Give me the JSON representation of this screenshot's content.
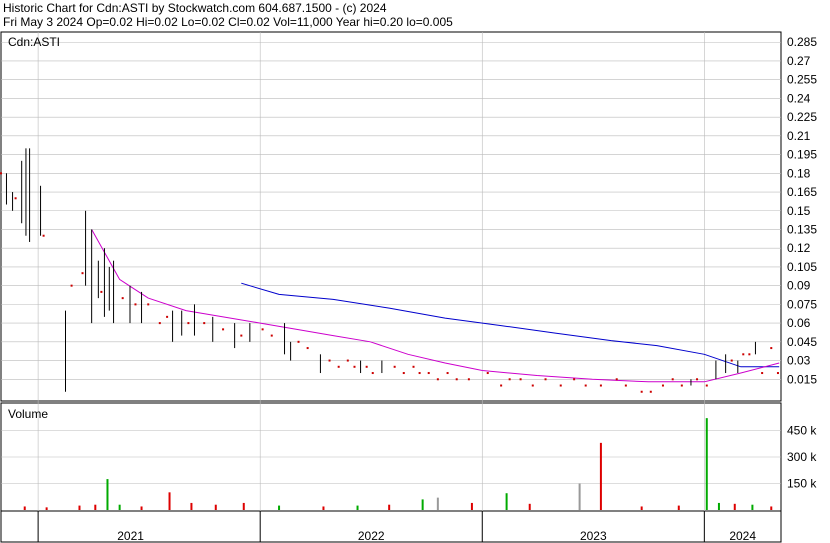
{
  "header": {
    "title": "Historic Chart for Cdn:ASTI by Stockwatch.com 604.687.1500 - (c) 2024",
    "summary": "Fri May  3 2024  Op=0.02  Hi=0.02  Lo=0.02  Cl=0.02  Vol=11,000  Year hi=0.20  lo=0.005"
  },
  "chart_data": [
    {
      "type": "ohlc",
      "panel_label": "Cdn:ASTI",
      "yticks": [
        "0.285",
        "0.27",
        "0.255",
        "0.24",
        "0.225",
        "0.21",
        "0.195",
        "0.18",
        "0.165",
        "0.15",
        "0.135",
        "0.12",
        "0.105",
        "0.09",
        "0.075",
        "0.06",
        "0.045",
        "0.03",
        "0.015"
      ],
      "ylim": [
        0.0,
        0.29
      ],
      "x_range": [
        "2020-11",
        "2024-05"
      ],
      "colors": {
        "bar": "#000000",
        "dot": "#cc0000",
        "ma_short": "#cc00cc",
        "ma_long": "#0000cc",
        "grid": "#bbbbbb"
      },
      "bars": [
        {
          "date": "2020-11-10",
          "high": 0.18,
          "low": 0.155
        },
        {
          "date": "2020-11-20",
          "high": 0.165,
          "low": 0.15
        },
        {
          "date": "2020-12-05",
          "high": 0.19,
          "low": 0.14
        },
        {
          "date": "2020-12-12",
          "high": 0.2,
          "low": 0.13
        },
        {
          "date": "2020-12-18",
          "high": 0.2,
          "low": 0.125
        },
        {
          "date": "2021-01-05",
          "high": 0.17,
          "low": 0.13
        },
        {
          "date": "2021-02-15",
          "high": 0.07,
          "low": 0.005
        },
        {
          "date": "2021-03-20",
          "high": 0.15,
          "low": 0.09
        },
        {
          "date": "2021-03-30",
          "high": 0.135,
          "low": 0.06
        },
        {
          "date": "2021-04-10",
          "high": 0.11,
          "low": 0.08
        },
        {
          "date": "2021-04-20",
          "high": 0.12,
          "low": 0.065
        },
        {
          "date": "2021-04-28",
          "high": 0.105,
          "low": 0.07
        },
        {
          "date": "2021-05-05",
          "high": 0.11,
          "low": 0.06
        },
        {
          "date": "2021-06-01",
          "high": 0.09,
          "low": 0.06
        },
        {
          "date": "2021-06-20",
          "high": 0.085,
          "low": 0.06
        },
        {
          "date": "2021-08-10",
          "high": 0.07,
          "low": 0.045
        },
        {
          "date": "2021-08-25",
          "high": 0.07,
          "low": 0.05
        },
        {
          "date": "2021-09-15",
          "high": 0.075,
          "low": 0.05
        },
        {
          "date": "2021-10-15",
          "high": 0.065,
          "low": 0.045
        },
        {
          "date": "2021-11-20",
          "high": 0.06,
          "low": 0.04
        },
        {
          "date": "2021-12-15",
          "high": 0.06,
          "low": 0.045
        },
        {
          "date": "2022-02-10",
          "high": 0.06,
          "low": 0.035
        },
        {
          "date": "2022-02-20",
          "high": 0.045,
          "low": 0.03
        },
        {
          "date": "2022-04-10",
          "high": 0.035,
          "low": 0.02
        },
        {
          "date": "2022-06-15",
          "high": 0.03,
          "low": 0.02
        },
        {
          "date": "2022-07-20",
          "high": 0.03,
          "low": 0.02
        },
        {
          "date": "2023-12-10",
          "high": 0.015,
          "low": 0.01
        },
        {
          "date": "2024-01-20",
          "high": 0.03,
          "low": 0.015
        },
        {
          "date": "2024-02-05",
          "high": 0.035,
          "low": 0.02
        },
        {
          "date": "2024-02-25",
          "high": 0.03,
          "low": 0.02
        },
        {
          "date": "2024-03-25",
          "high": 0.045,
          "low": 0.035
        }
      ],
      "dots": [
        {
          "date": "2020-11-01",
          "price": 0.18
        },
        {
          "date": "2020-11-25",
          "price": 0.16
        },
        {
          "date": "2021-01-10",
          "price": 0.13
        },
        {
          "date": "2021-02-25",
          "price": 0.09
        },
        {
          "date": "2021-03-15",
          "price": 0.1
        },
        {
          "date": "2021-04-15",
          "price": 0.085
        },
        {
          "date": "2021-05-20",
          "price": 0.08
        },
        {
          "date": "2021-06-10",
          "price": 0.075
        },
        {
          "date": "2021-07-01",
          "price": 0.075
        },
        {
          "date": "2021-07-20",
          "price": 0.06
        },
        {
          "date": "2021-08-01",
          "price": 0.065
        },
        {
          "date": "2021-09-05",
          "price": 0.06
        },
        {
          "date": "2021-10-01",
          "price": 0.06
        },
        {
          "date": "2021-11-01",
          "price": 0.055
        },
        {
          "date": "2021-12-01",
          "price": 0.05
        },
        {
          "date": "2022-01-05",
          "price": 0.055
        },
        {
          "date": "2022-01-20",
          "price": 0.05
        },
        {
          "date": "2022-03-05",
          "price": 0.045
        },
        {
          "date": "2022-03-20",
          "price": 0.04
        },
        {
          "date": "2022-04-25",
          "price": 0.03
        },
        {
          "date": "2022-05-10",
          "price": 0.025
        },
        {
          "date": "2022-05-25",
          "price": 0.03
        },
        {
          "date": "2022-06-05",
          "price": 0.025
        },
        {
          "date": "2022-06-25",
          "price": 0.025
        },
        {
          "date": "2022-07-05",
          "price": 0.02
        },
        {
          "date": "2022-08-10",
          "price": 0.025
        },
        {
          "date": "2022-08-25",
          "price": 0.02
        },
        {
          "date": "2022-09-10",
          "price": 0.025
        },
        {
          "date": "2022-09-20",
          "price": 0.02
        },
        {
          "date": "2022-10-05",
          "price": 0.02
        },
        {
          "date": "2022-10-20",
          "price": 0.015
        },
        {
          "date": "2022-11-05",
          "price": 0.02
        },
        {
          "date": "2022-11-20",
          "price": 0.015
        },
        {
          "date": "2022-12-10",
          "price": 0.015
        },
        {
          "date": "2023-01-10",
          "price": 0.02
        },
        {
          "date": "2023-02-01",
          "price": 0.01
        },
        {
          "date": "2023-02-15",
          "price": 0.015
        },
        {
          "date": "2023-03-05",
          "price": 0.015
        },
        {
          "date": "2023-03-25",
          "price": 0.01
        },
        {
          "date": "2023-04-15",
          "price": 0.015
        },
        {
          "date": "2023-05-10",
          "price": 0.01
        },
        {
          "date": "2023-06-01",
          "price": 0.015
        },
        {
          "date": "2023-06-20",
          "price": 0.01
        },
        {
          "date": "2023-07-15",
          "price": 0.01
        },
        {
          "date": "2023-08-10",
          "price": 0.015
        },
        {
          "date": "2023-08-25",
          "price": 0.01
        },
        {
          "date": "2023-09-20",
          "price": 0.005
        },
        {
          "date": "2023-10-05",
          "price": 0.005
        },
        {
          "date": "2023-10-25",
          "price": 0.01
        },
        {
          "date": "2023-11-10",
          "price": 0.015
        },
        {
          "date": "2023-11-25",
          "price": 0.01
        },
        {
          "date": "2023-12-20",
          "price": 0.015
        },
        {
          "date": "2024-01-05",
          "price": 0.01
        },
        {
          "date": "2024-02-15",
          "price": 0.03
        },
        {
          "date": "2024-03-05",
          "price": 0.035
        },
        {
          "date": "2024-03-15",
          "price": 0.035
        },
        {
          "date": "2024-04-05",
          "price": 0.02
        },
        {
          "date": "2024-04-20",
          "price": 0.04
        },
        {
          "date": "2024-05-01",
          "price": 0.02
        }
      ],
      "ma_short": [
        {
          "date": "2021-03-30",
          "value": 0.135
        },
        {
          "date": "2021-05-15",
          "value": 0.095
        },
        {
          "date": "2021-07-01",
          "value": 0.08
        },
        {
          "date": "2021-09-01",
          "value": 0.07
        },
        {
          "date": "2021-11-01",
          "value": 0.065
        },
        {
          "date": "2022-01-01",
          "value": 0.06
        },
        {
          "date": "2022-03-01",
          "value": 0.055
        },
        {
          "date": "2022-05-01",
          "value": 0.05
        },
        {
          "date": "2022-07-01",
          "value": 0.045
        },
        {
          "date": "2022-09-01",
          "value": 0.035
        },
        {
          "date": "2022-11-01",
          "value": 0.028
        },
        {
          "date": "2023-01-01",
          "value": 0.022
        },
        {
          "date": "2023-04-01",
          "value": 0.018
        },
        {
          "date": "2023-07-01",
          "value": 0.015
        },
        {
          "date": "2023-10-01",
          "value": 0.013
        },
        {
          "date": "2024-01-01",
          "value": 0.013
        },
        {
          "date": "2024-03-01",
          "value": 0.02
        },
        {
          "date": "2024-05-03",
          "value": 0.028
        }
      ],
      "ma_long": [
        {
          "date": "2021-12-01",
          "value": 0.092
        },
        {
          "date": "2022-02-01",
          "value": 0.083
        },
        {
          "date": "2022-05-01",
          "value": 0.079
        },
        {
          "date": "2022-08-01",
          "value": 0.072
        },
        {
          "date": "2022-11-01",
          "value": 0.064
        },
        {
          "date": "2023-02-01",
          "value": 0.058
        },
        {
          "date": "2023-05-01",
          "value": 0.052
        },
        {
          "date": "2023-08-01",
          "value": 0.046
        },
        {
          "date": "2023-10-15",
          "value": 0.042
        },
        {
          "date": "2024-01-01",
          "value": 0.035
        },
        {
          "date": "2024-03-01",
          "value": 0.025
        },
        {
          "date": "2024-05-03",
          "value": 0.025
        }
      ]
    },
    {
      "type": "bar",
      "panel_label": "Volume",
      "yticks": [
        "450 k",
        "300 k",
        "150 k"
      ],
      "ylim": [
        0,
        600000
      ],
      "x_range": [
        "2020-11",
        "2024-05"
      ],
      "xticks": [
        "2021",
        "2022",
        "2023",
        "2024"
      ],
      "colors": {
        "up": "#00aa00",
        "down": "#dd0000",
        "flat": "#999999"
      },
      "bars": [
        {
          "date": "2020-12-10",
          "volume": 20000,
          "dir": "down"
        },
        {
          "date": "2021-01-15",
          "volume": 15000,
          "dir": "down"
        },
        {
          "date": "2021-03-10",
          "volume": 25000,
          "dir": "down"
        },
        {
          "date": "2021-04-05",
          "volume": 30000,
          "dir": "down"
        },
        {
          "date": "2021-04-25",
          "volume": 175000,
          "dir": "up"
        },
        {
          "date": "2021-05-15",
          "volume": 30000,
          "dir": "up"
        },
        {
          "date": "2021-06-20",
          "volume": 20000,
          "dir": "down"
        },
        {
          "date": "2021-08-05",
          "volume": 100000,
          "dir": "down"
        },
        {
          "date": "2021-09-10",
          "volume": 40000,
          "dir": "down"
        },
        {
          "date": "2021-10-20",
          "volume": 30000,
          "dir": "down"
        },
        {
          "date": "2021-12-05",
          "volume": 40000,
          "dir": "down"
        },
        {
          "date": "2022-02-01",
          "volume": 25000,
          "dir": "up"
        },
        {
          "date": "2022-04-15",
          "volume": 20000,
          "dir": "down"
        },
        {
          "date": "2022-06-10",
          "volume": 25000,
          "dir": "up"
        },
        {
          "date": "2022-08-01",
          "volume": 30000,
          "dir": "down"
        },
        {
          "date": "2022-09-25",
          "volume": 60000,
          "dir": "up"
        },
        {
          "date": "2022-10-20",
          "volume": 70000,
          "dir": "flat"
        },
        {
          "date": "2022-12-15",
          "volume": 40000,
          "dir": "down"
        },
        {
          "date": "2023-02-10",
          "volume": 95000,
          "dir": "up"
        },
        {
          "date": "2023-03-20",
          "volume": 35000,
          "dir": "down"
        },
        {
          "date": "2023-06-10",
          "volume": 150000,
          "dir": "flat"
        },
        {
          "date": "2023-07-15",
          "volume": 380000,
          "dir": "down"
        },
        {
          "date": "2023-09-20",
          "volume": 20000,
          "dir": "down"
        },
        {
          "date": "2023-11-20",
          "volume": 25000,
          "dir": "down"
        },
        {
          "date": "2024-01-05",
          "volume": 520000,
          "dir": "up"
        },
        {
          "date": "2024-01-25",
          "volume": 40000,
          "dir": "up"
        },
        {
          "date": "2024-02-20",
          "volume": 35000,
          "dir": "down"
        },
        {
          "date": "2024-03-20",
          "volume": 30000,
          "dir": "up"
        },
        {
          "date": "2024-04-20",
          "volume": 20000,
          "dir": "down"
        }
      ]
    }
  ]
}
